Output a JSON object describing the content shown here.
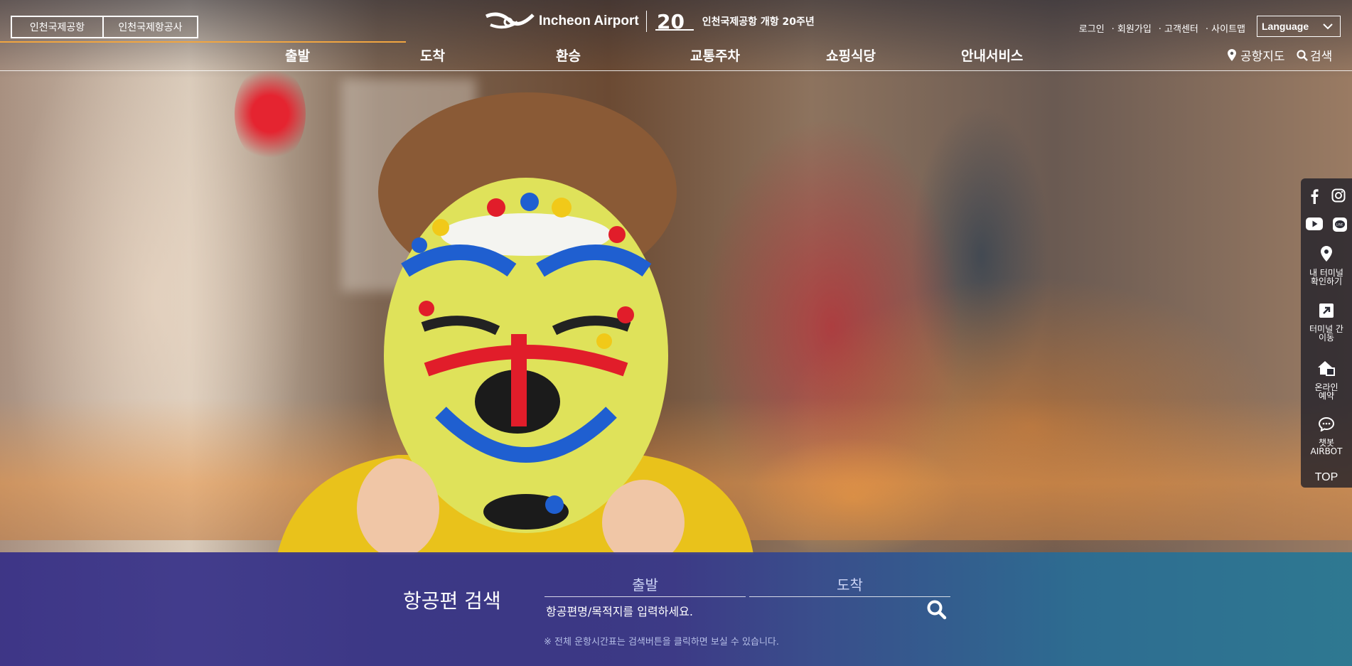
{
  "header": {
    "corp_tabs": [
      "인천국제공항",
      "인천국제항공사"
    ],
    "logo_text": "Incheon Airport",
    "anniversary_text": "인천국제공항 개항 20주년",
    "util_links": [
      "로그인",
      "· 회원가입",
      "· 고객센터",
      "· 사이트맵"
    ],
    "language_label": "Language"
  },
  "gnb": {
    "items": [
      "출발",
      "도착",
      "환승",
      "교통주차",
      "쇼핑식당",
      "안내서비스"
    ],
    "map_label": "공항지도",
    "search_label": "검색"
  },
  "quick_menu": {
    "terminal_check": "내 터미널\n확인하기",
    "terminal_move": "터미널 간\n이동",
    "online_reserve": "온라인\n예약",
    "chatbot": "챗봇\nAIRBOT",
    "top": "TOP"
  },
  "flight_search": {
    "title": "항공편 검색",
    "tabs": [
      "출발",
      "도착"
    ],
    "placeholder": "항공편명/목적지를 입력하세요.",
    "note": "※ 전체 운항시간표는 검색버튼을 클릭하면 보실 수 있습니다."
  },
  "colors": {
    "accent_line": "#f0a541",
    "panel_start": "#362f87",
    "panel_end": "#23789a"
  }
}
